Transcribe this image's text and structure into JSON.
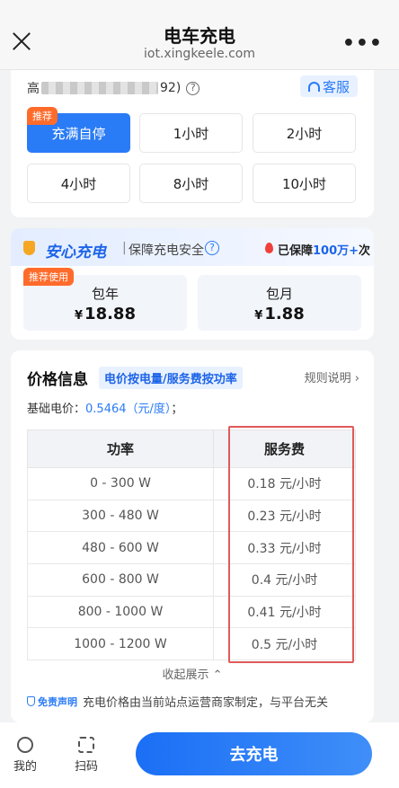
{
  "header": {
    "title": "电车充电",
    "subtitle": "iot.xingkeele.com",
    "more": "•••"
  },
  "device": {
    "name_prefix": "高",
    "name_suffix": "92)",
    "help": "?"
  },
  "customer_service": {
    "label": "客服"
  },
  "durations": {
    "recommend_tag": "推荐",
    "options": [
      "充满自停",
      "1小时",
      "2小时",
      "4小时",
      "8小时",
      "10小时"
    ],
    "selected": "充满自停"
  },
  "insurance": {
    "brand": "安心充电",
    "separator": "|",
    "desc": "保障充电安全",
    "help": "?",
    "guarantee_prefix": "已保障",
    "guarantee_count": "100万+",
    "guarantee_suffix": "次",
    "recommend_tag": "推荐使用",
    "packages": [
      {
        "name": "包年",
        "currency": "¥",
        "price": "18.88"
      },
      {
        "name": "包月",
        "currency": "¥",
        "price": "1.88"
      }
    ]
  },
  "price_info": {
    "title": "价格信息",
    "chip": "电价按电量/服务费按功率",
    "rules_link": "规则说明 ›",
    "base_label": "基础电价：",
    "base_value": "0.5464（元/度）",
    "base_end": "；",
    "table": {
      "headers": [
        "功率",
        "服务费"
      ],
      "rows": [
        [
          "0 - 300 W",
          "0.18 元/小时"
        ],
        [
          "300 - 480 W",
          "0.23 元/小时"
        ],
        [
          "480 - 600 W",
          "0.33 元/小时"
        ],
        [
          "600 - 800 W",
          "0.4 元/小时"
        ],
        [
          "800 - 1000 W",
          "0.41 元/小时"
        ],
        [
          "1000 - 1200 W",
          "0.5 元/小时"
        ]
      ]
    },
    "collapse": "收起展示 ⌃",
    "disclaimer_tag": "免责声明",
    "disclaimer_text": "充电价格由当前站点运营商家制定，与平台无关"
  },
  "bottom_nav": {
    "mine": "我的",
    "scan": "扫码",
    "cta": "去充电"
  },
  "colors": {
    "primary": "#2a7bf6",
    "accent_orange": "#ff6b2b",
    "highlight_red": "#e05a5a"
  }
}
